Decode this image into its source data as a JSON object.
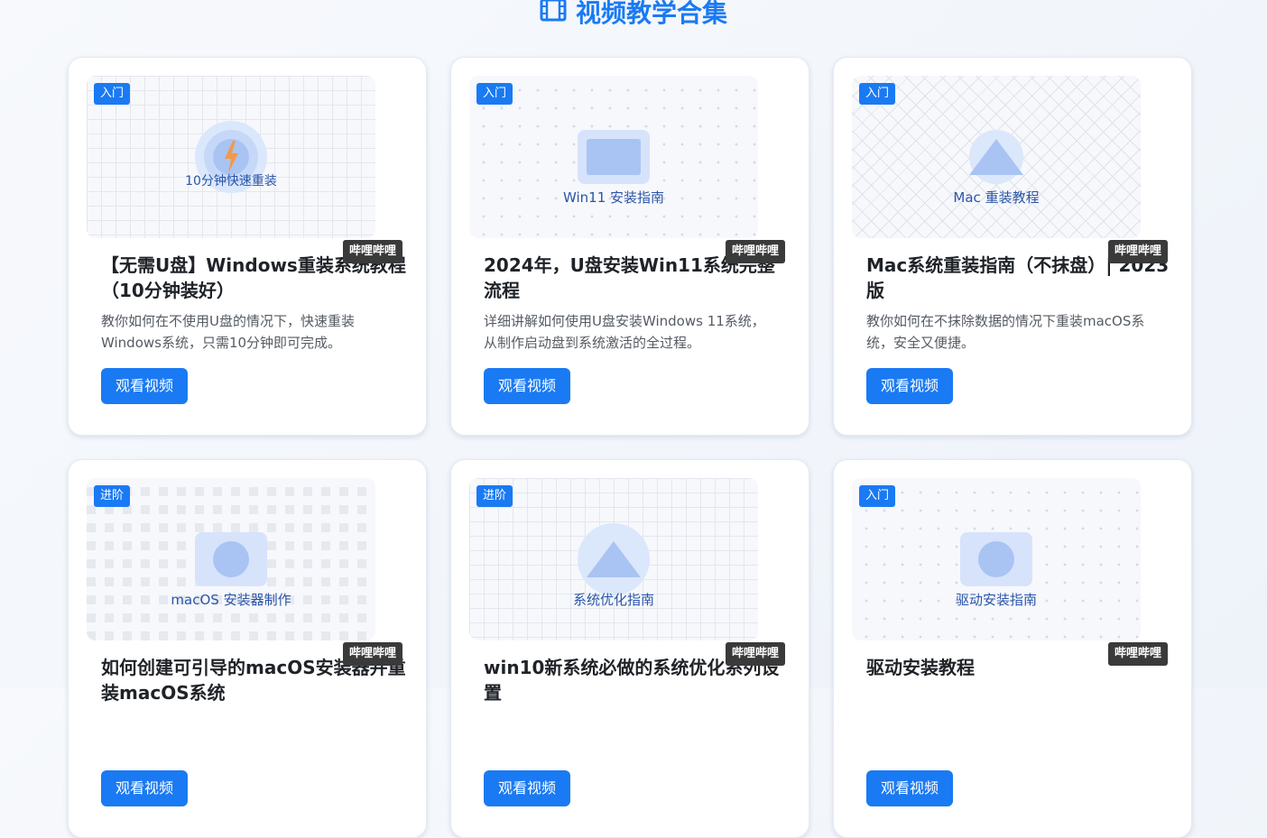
{
  "page": {
    "title": "视频教学合集",
    "accent_color": "#1a7af3"
  },
  "cards": [
    {
      "level": "入门",
      "platform": "哔哩哔哩",
      "thumb_caption": "10分钟快速重装",
      "thumb_icon": "lightning-icon",
      "title": "【无需U盘】Windows重装系统教程（10分钟装好）",
      "description": "教你如何在不使用U盘的情况下，快速重装Windows系统，只需10分钟即可完成。",
      "button": "观看视频"
    },
    {
      "level": "入门",
      "platform": "哔哩哔哩",
      "thumb_caption": "Win11 安装指南",
      "thumb_icon": "monitor-icon",
      "title": "2024年，U盘安装Win11系统完整流程",
      "description": "详细讲解如何使用U盘安装Windows 11系统，从制作启动盘到系统激活的全过程。",
      "button": "观看视频"
    },
    {
      "level": "入门",
      "platform": "哔哩哔哩",
      "thumb_caption": "Mac 重装教程",
      "thumb_icon": "triangle-icon",
      "title": "Mac系统重装指南（不抹盘）| 2023版",
      "description": "教你如何在不抹除数据的情况下重装macOS系统，安全又便捷。",
      "button": "观看视频"
    },
    {
      "level": "进阶",
      "platform": "哔哩哔哩",
      "thumb_caption": "macOS 安装器制作",
      "thumb_icon": "circle-icon",
      "title": "如何创建可引导的macOS安装器并重装macOS系统",
      "description": "",
      "button": "观看视频"
    },
    {
      "level": "进阶",
      "platform": "哔哩哔哩",
      "thumb_caption": "系统优化指南",
      "thumb_icon": "triangle-icon",
      "title": "win10新系统必做的系统优化系列设置",
      "description": "",
      "button": "观看视频"
    },
    {
      "level": "入门",
      "platform": "哔哩哔哩",
      "thumb_caption": "驱动安装指南",
      "thumb_icon": "circle-icon",
      "title": "驱动安装教程",
      "description": "",
      "button": "观看视频"
    }
  ]
}
